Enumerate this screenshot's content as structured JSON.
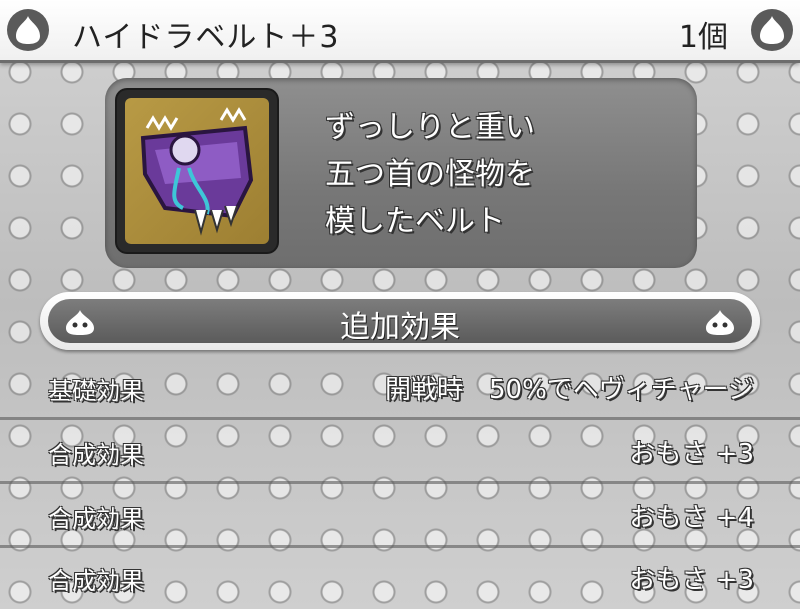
{
  "header": {
    "item_name": "ハイドラベルト＋3",
    "count": "1個"
  },
  "item": {
    "icon": "hydra-belt-icon",
    "description_lines": [
      "ずっしりと重い",
      "五つ首の怪物を",
      "模したベルト"
    ]
  },
  "effects": {
    "section_title": "追加効果",
    "rows": [
      {
        "name": "基礎効果",
        "value": "開戦時　50%でヘヴィチャージ"
      },
      {
        "name": "合成効果",
        "value": "おもさ +3"
      },
      {
        "name": "合成効果",
        "value": "おもさ +4"
      },
      {
        "name": "合成効果",
        "value": "おもさ +3"
      }
    ]
  },
  "colors": {
    "header_bg": "#ffffff",
    "panel_bg": "#7a7a7a",
    "item_bg": "#b0913d",
    "text_outline": "#333333"
  }
}
